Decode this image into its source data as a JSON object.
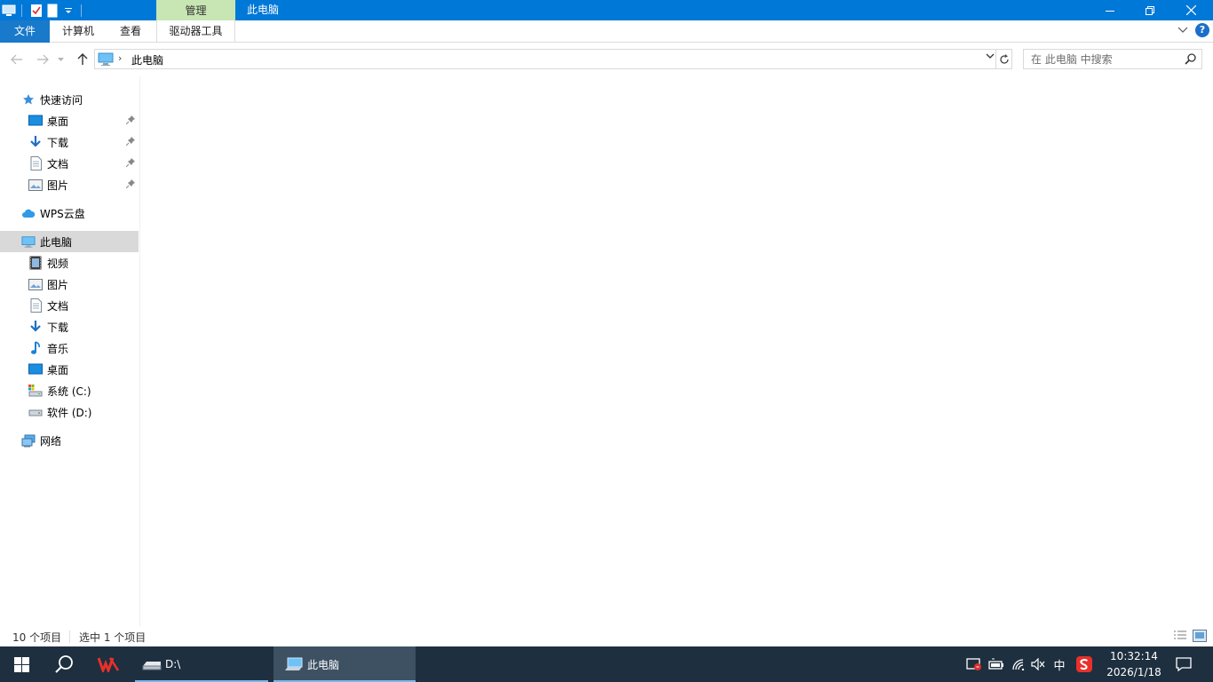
{
  "window": {
    "title": "此电脑",
    "context_tab": "管理"
  },
  "ribbon": {
    "tabs": [
      "文件",
      "计算机",
      "查看",
      "驱动器工具"
    ]
  },
  "address": {
    "crumb": "此电脑"
  },
  "search": {
    "placeholder": "在 此电脑 中搜索"
  },
  "sidebar": {
    "quick_access": "快速访问",
    "quick_items": [
      {
        "label": "桌面",
        "icon": "desktop-icon"
      },
      {
        "label": "下载",
        "icon": "download-icon"
      },
      {
        "label": "文档",
        "icon": "document-icon"
      },
      {
        "label": "图片",
        "icon": "picture-icon"
      }
    ],
    "wps": "WPS云盘",
    "this_pc": "此电脑",
    "pc_items": [
      {
        "label": "视频",
        "icon": "video-icon"
      },
      {
        "label": "图片",
        "icon": "picture-icon"
      },
      {
        "label": "文档",
        "icon": "document-icon"
      },
      {
        "label": "下载",
        "icon": "download-icon"
      },
      {
        "label": "音乐",
        "icon": "music-icon"
      },
      {
        "label": "桌面",
        "icon": "desktop-icon"
      },
      {
        "label": "系统 (C:)",
        "icon": "system-drive-icon"
      },
      {
        "label": "软件 (D:)",
        "icon": "drive-icon"
      }
    ],
    "network": "网络"
  },
  "status": {
    "item_count": "10 个项目",
    "selected": "选中 1 个项目"
  },
  "taskbar": {
    "apps": [
      {
        "label": "D:\\",
        "icon": "drive-icon"
      },
      {
        "label": "此电脑",
        "icon": "this-pc-icon"
      }
    ],
    "ime": "中",
    "time": "10:32:14",
    "date": "2026/1/18"
  },
  "colors": {
    "titlebar": "#0078d7",
    "context_tab": "#c7e6b4",
    "file_tab": "#1979ca",
    "taskbar": "#1e2f3f",
    "selected": "#d9d9d9"
  }
}
